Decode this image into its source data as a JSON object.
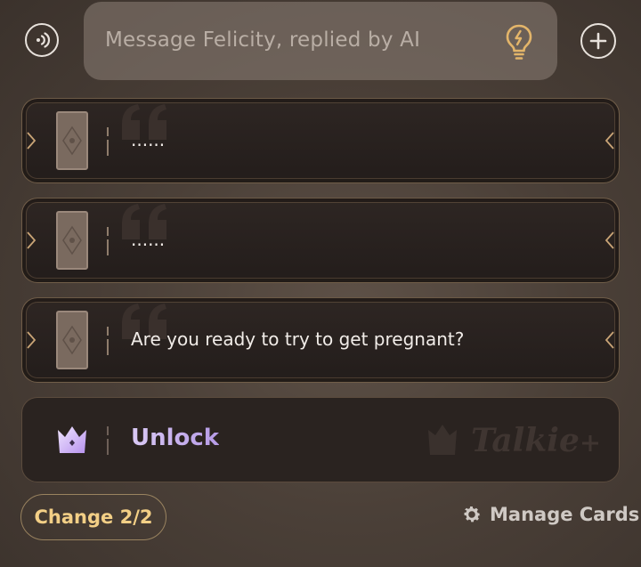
{
  "composer": {
    "placeholder": "Message Felicity, replied by AI",
    "voice_icon": "voice-wave-icon",
    "hint_icon": "lightbulb-icon",
    "add_icon": "plus-icon"
  },
  "reply_cards": [
    {
      "text": "......"
    },
    {
      "text": "......"
    },
    {
      "text": "Are you ready to try to get pregnant?"
    }
  ],
  "unlock": {
    "label": "Unlock",
    "brand": "Talkie"
  },
  "footer": {
    "change_label": "Change 2/2",
    "manage_label": "Manage Cards"
  },
  "colors": {
    "accent_gold": "#f3cf86",
    "unlock_purple": "#c7b0ee",
    "card_bg": "#2a2320"
  }
}
